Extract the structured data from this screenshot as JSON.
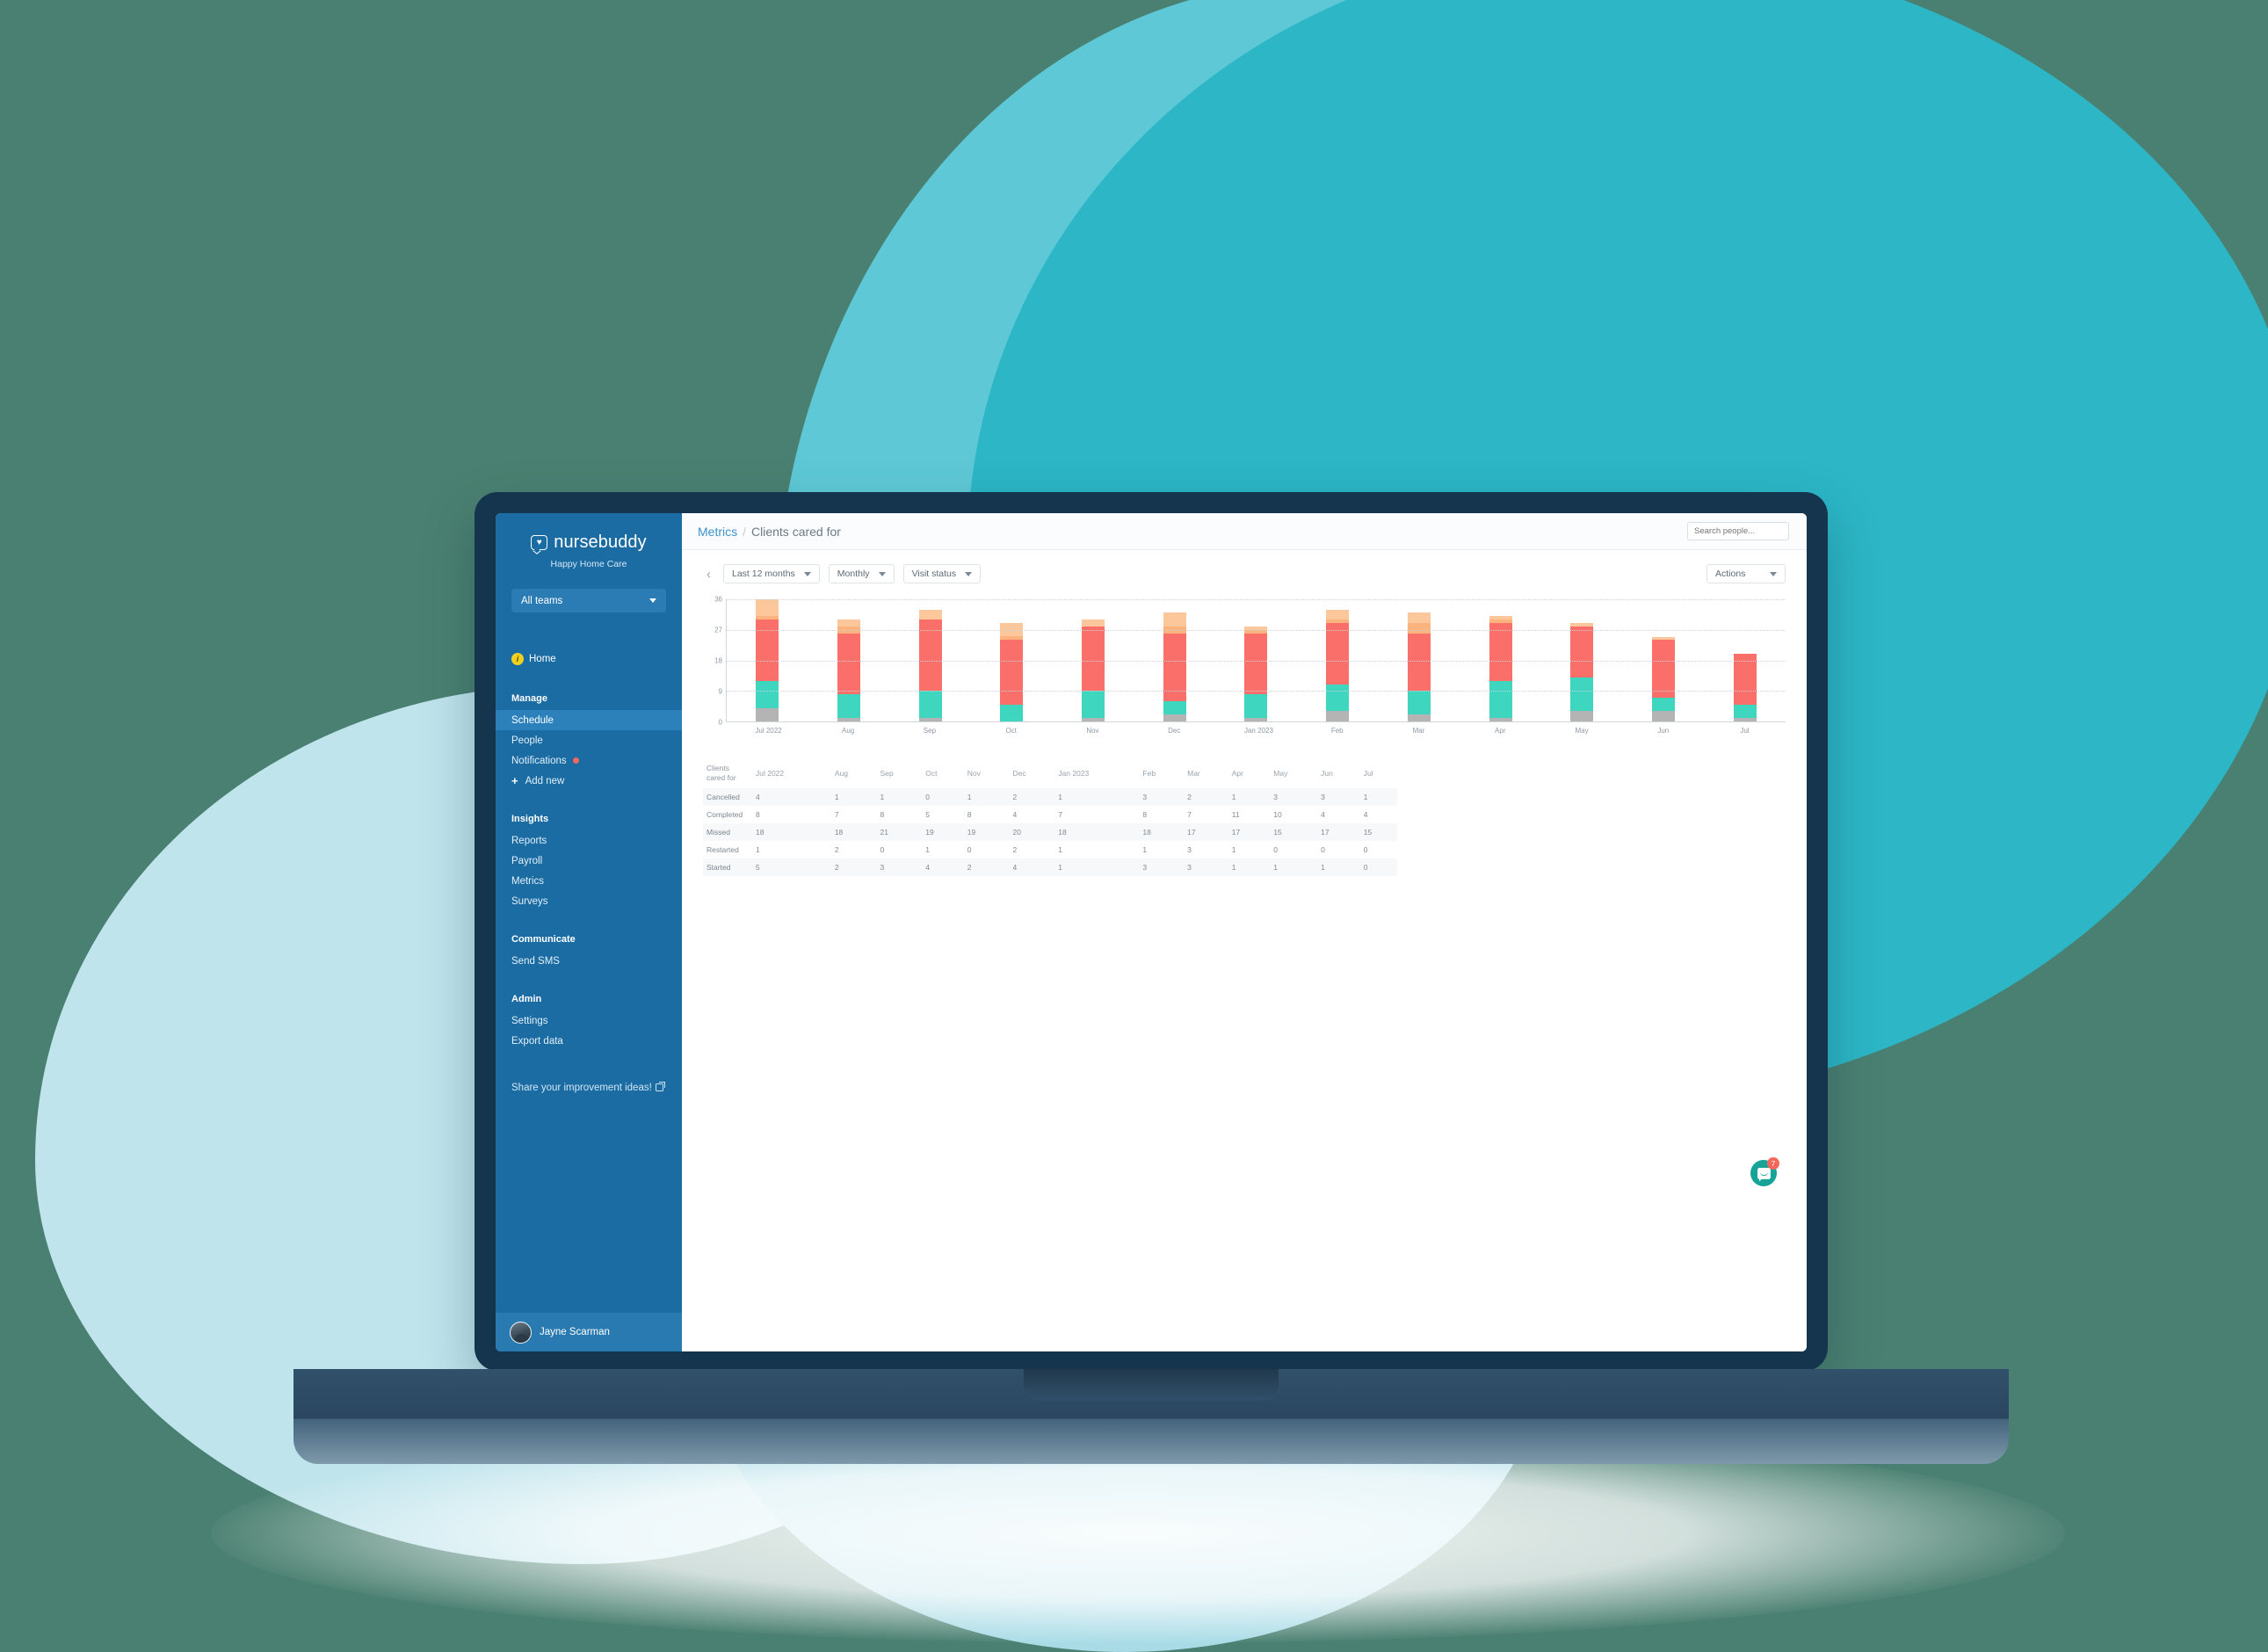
{
  "sidebar": {
    "brand_name": "nursebuddy",
    "brand_sub": "Happy Home Care",
    "team_select": "All teams",
    "home_label": "Home",
    "home_badge": "i",
    "groups": [
      {
        "title": "Manage",
        "items": [
          {
            "label": "Schedule",
            "active": true
          },
          {
            "label": "People",
            "active": false
          },
          {
            "label": "Notifications",
            "active": false,
            "dot": true
          },
          {
            "label": "Add new",
            "active": false,
            "plus": true
          }
        ]
      },
      {
        "title": "Insights",
        "items": [
          {
            "label": "Reports"
          },
          {
            "label": "Payroll"
          },
          {
            "label": "Metrics"
          },
          {
            "label": "Surveys"
          }
        ]
      },
      {
        "title": "Communicate",
        "items": [
          {
            "label": "Send SMS"
          }
        ]
      },
      {
        "title": "Admin",
        "items": [
          {
            "label": "Settings"
          },
          {
            "label": "Export data"
          }
        ]
      }
    ],
    "improve_link": "Share your improvement ideas!",
    "user_name": "Jayne Scarman"
  },
  "topbar": {
    "breadcrumb_root": "Metrics",
    "breadcrumb_sep": "/",
    "breadcrumb_current": "Clients cared for",
    "search_placeholder": "Search people..."
  },
  "toolbar": {
    "prev_label": "‹",
    "range_filter": "Last 12 months",
    "interval_filter": "Monthly",
    "status_filter": "Visit status",
    "actions_label": "Actions"
  },
  "chat": {
    "badge": "7"
  },
  "colors": {
    "cancelled": "#b4b4b4",
    "completed": "#3fd6c0",
    "missed": "#fa6f6a",
    "restarted": "#fcb37e",
    "started": "#fcc79b",
    "sidebar": "#1c6ca4",
    "accent_link": "#3d93c9",
    "chat": "#17a398",
    "badge": "#f4675d"
  },
  "chart_data": {
    "type": "bar",
    "stacked": true,
    "title": "Clients cared for",
    "xlabel": "",
    "ylabel": "",
    "ylim": [
      0,
      36
    ],
    "yticks": [
      0,
      9,
      18,
      27,
      36
    ],
    "grid": true,
    "legend": "none",
    "categories": [
      "Jul 2022",
      "Aug",
      "Sep",
      "Oct",
      "Nov",
      "Dec",
      "Jan 2023",
      "Feb",
      "Mar",
      "Apr",
      "May",
      "Jun",
      "Jul"
    ],
    "series": [
      {
        "name": "Cancelled",
        "color": "#b4b4b4",
        "values": [
          4,
          1,
          1,
          0,
          1,
          2,
          1,
          3,
          2,
          1,
          3,
          3,
          1
        ]
      },
      {
        "name": "Completed",
        "color": "#3fd6c0",
        "values": [
          8,
          7,
          8,
          5,
          8,
          4,
          7,
          8,
          7,
          11,
          10,
          4,
          4
        ]
      },
      {
        "name": "Missed",
        "color": "#fa6f6a",
        "values": [
          18,
          18,
          21,
          19,
          19,
          20,
          18,
          18,
          17,
          17,
          15,
          17,
          15
        ]
      },
      {
        "name": "Restarted",
        "color": "#fcb37e",
        "values": [
          1,
          2,
          0,
          1,
          0,
          2,
          1,
          1,
          3,
          1,
          0,
          0,
          0
        ]
      },
      {
        "name": "Started",
        "color": "#fcc79b",
        "values": [
          5,
          2,
          3,
          4,
          2,
          4,
          1,
          3,
          3,
          1,
          1,
          1,
          0
        ]
      }
    ]
  },
  "table": {
    "corner_line1": "Clients",
    "corner_line2": "cared for",
    "columns": [
      "Jul 2022",
      "Aug",
      "Sep",
      "Oct",
      "Nov",
      "Dec",
      "Jan 2023",
      "Feb",
      "Mar",
      "Apr",
      "May",
      "Jun",
      "Jul"
    ],
    "rows": [
      {
        "label": "Cancelled",
        "values": [
          4,
          1,
          1,
          0,
          1,
          2,
          1,
          3,
          2,
          1,
          3,
          3,
          1
        ]
      },
      {
        "label": "Completed",
        "values": [
          8,
          7,
          8,
          5,
          8,
          4,
          7,
          8,
          7,
          11,
          10,
          4,
          4
        ]
      },
      {
        "label": "Missed",
        "values": [
          18,
          18,
          21,
          19,
          19,
          20,
          18,
          18,
          17,
          17,
          15,
          17,
          15
        ]
      },
      {
        "label": "Restarted",
        "values": [
          1,
          2,
          0,
          1,
          0,
          2,
          1,
          1,
          3,
          1,
          0,
          0,
          0
        ]
      },
      {
        "label": "Started",
        "values": [
          5,
          2,
          3,
          4,
          2,
          4,
          1,
          3,
          3,
          1,
          1,
          1,
          0
        ]
      }
    ]
  }
}
